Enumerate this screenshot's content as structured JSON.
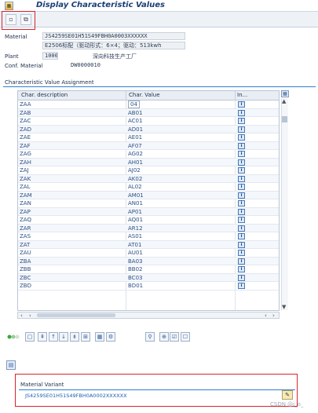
{
  "title": "Display Characteristic Values",
  "header": {
    "material_label": "Material",
    "material_value": "JS4259SE01H51S49FBH0A0003XXXXXX",
    "material_desc": "E2506标配（驱动形式：6×4；驱动：513kwh",
    "plant_label": "Plant",
    "plant_value": "1000",
    "plant_desc": "深向科技生产工厂",
    "conf_label": "Conf. Material",
    "conf_value": "DW0000010"
  },
  "section_title": "Characteristic Value Assignment",
  "table": {
    "columns": [
      "Char. description",
      "Char. Value",
      "In..."
    ],
    "rows": [
      {
        "desc": "ZAA",
        "value": "04"
      },
      {
        "desc": "ZAB",
        "value": "AB01"
      },
      {
        "desc": "ZAC",
        "value": "AC01"
      },
      {
        "desc": "ZAD",
        "value": "AD01"
      },
      {
        "desc": "ZAE",
        "value": "AE01"
      },
      {
        "desc": "ZAF",
        "value": "AF07"
      },
      {
        "desc": "ZAG",
        "value": "AG02"
      },
      {
        "desc": "ZAH",
        "value": "AH01"
      },
      {
        "desc": "ZAJ",
        "value": "AJ02"
      },
      {
        "desc": "ZAK",
        "value": "AK02"
      },
      {
        "desc": "ZAL",
        "value": "AL02"
      },
      {
        "desc": "ZAM",
        "value": "AM01"
      },
      {
        "desc": "ZAN",
        "value": "AN01"
      },
      {
        "desc": "ZAP",
        "value": "AP01"
      },
      {
        "desc": "ZAQ",
        "value": "AQ01"
      },
      {
        "desc": "ZAR",
        "value": "AR12"
      },
      {
        "desc": "ZAS",
        "value": "AS01"
      },
      {
        "desc": "ZAT",
        "value": "AT01"
      },
      {
        "desc": "ZAU",
        "value": "AU01"
      },
      {
        "desc": "ZBA",
        "value": "BA03"
      },
      {
        "desc": "ZBB",
        "value": "BB02"
      },
      {
        "desc": "ZBC",
        "value": "BC03"
      },
      {
        "desc": "ZBD",
        "value": "BD01"
      }
    ]
  },
  "material_variant": {
    "label": "Material Variant",
    "value": "JS4259SE01H51S49FBH0A0002XXXXXX"
  },
  "watermark": "CSDN @i_o_",
  "colors": {
    "accent": "#2f7fd0",
    "title": "#1a3e78",
    "highlight_box": "#d9232c"
  }
}
